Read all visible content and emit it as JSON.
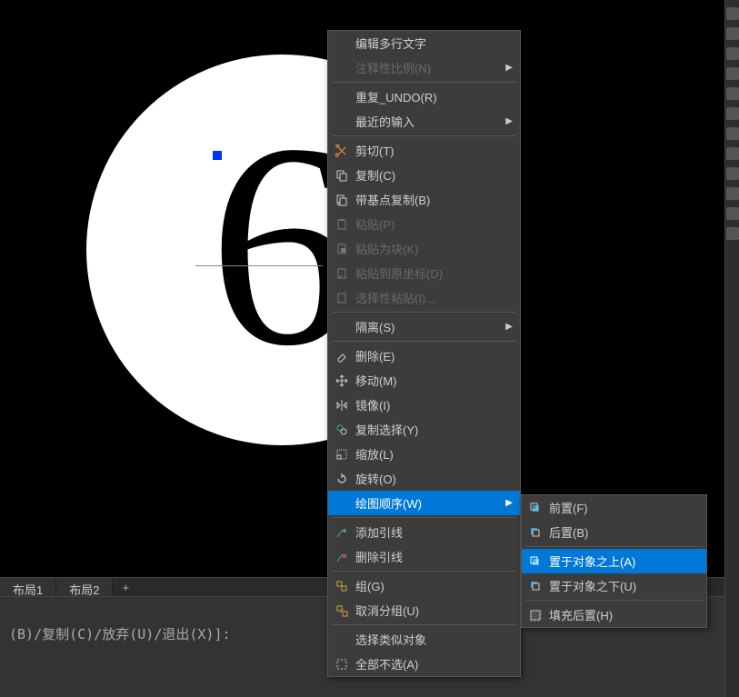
{
  "canvas": {
    "text": "6"
  },
  "tabs": {
    "layout1": "布局1",
    "layout2": "布局2",
    "add": "+"
  },
  "command_line": "(B)/复制(C)/放弃(U)/退出(X)]:",
  "menu": {
    "edit_mtext": "编辑多行文字",
    "annotative_scale": "注释性比例(N)",
    "repeat_undo": "重复_UNDO(R)",
    "recent_input": "最近的输入",
    "cut": "剪切(T)",
    "copy": "复制(C)",
    "copy_base": "带基点复制(B)",
    "paste": "粘贴(P)",
    "paste_block": "粘贴为块(K)",
    "paste_orig": "粘贴到原坐标(D)",
    "paste_special": "选择性粘贴(I)...",
    "isolate": "隔离(S)",
    "erase": "删除(E)",
    "move": "移动(M)",
    "mirror": "镜像(I)",
    "copy_select": "复制选择(Y)",
    "scale": "缩放(L)",
    "rotate": "旋转(O)",
    "draw_order": "绘图顺序(W)",
    "add_leader": "添加引线",
    "remove_leader": "删除引线",
    "group": "组(G)",
    "ungroup": "取消分组(U)",
    "select_similar": "选择类似对象",
    "deselect_all": "全部不选(A)"
  },
  "submenu": {
    "bring_front": "前置(F)",
    "send_back": "后置(B)",
    "above_obj": "置于对象之上(A)",
    "below_obj": "置于对象之下(U)",
    "hatch_back": "填充后置(H)"
  }
}
